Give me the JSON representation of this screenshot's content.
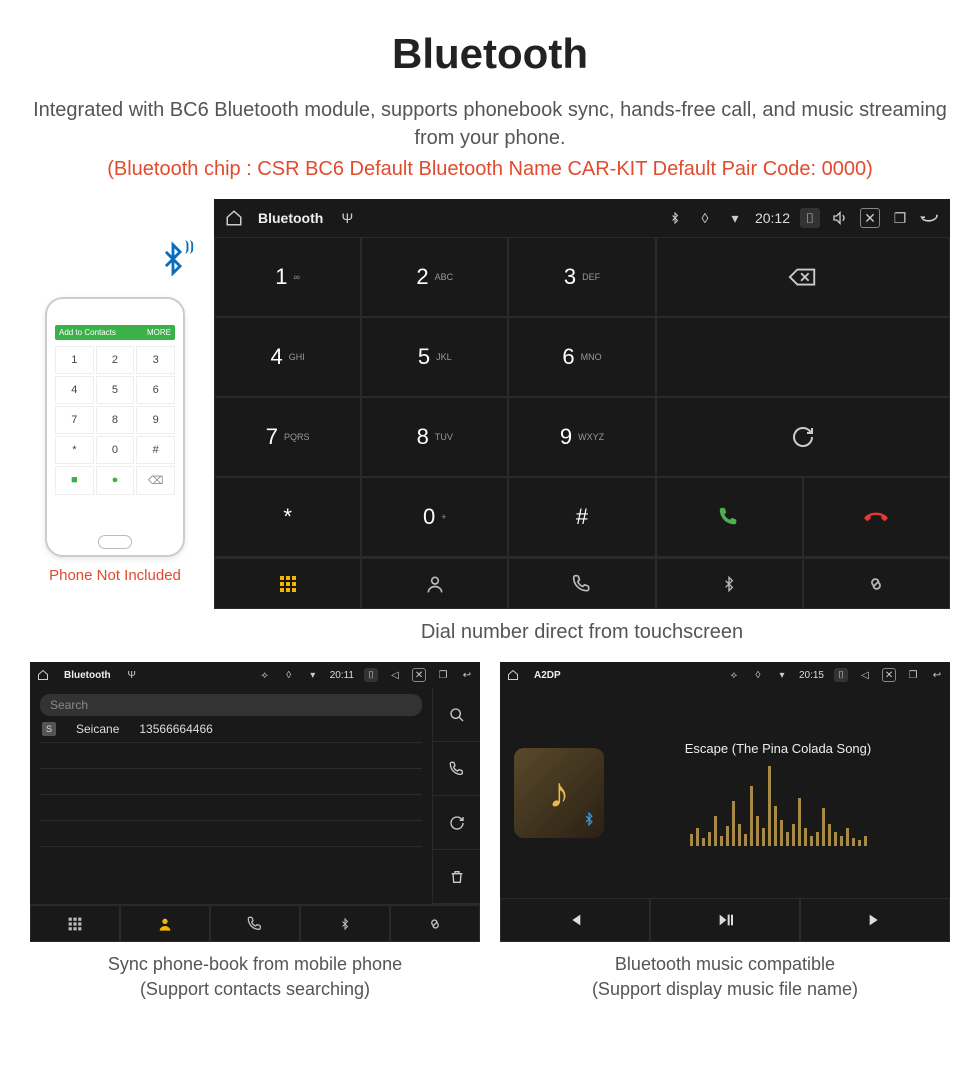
{
  "header": {
    "title": "Bluetooth",
    "subtitle": "Integrated with BC6 Bluetooth module, supports phonebook sync, hands-free call, and music streaming from your phone.",
    "meta": "(Bluetooth chip : CSR BC6    Default Bluetooth Name CAR-KIT    Default Pair Code: 0000)"
  },
  "phone": {
    "caption": "Phone Not Included",
    "add_contacts": "Add to Contacts",
    "more": "MORE",
    "keys": [
      "1",
      "2",
      "3",
      "4",
      "5",
      "6",
      "7",
      "8",
      "9",
      "*",
      "0",
      "#"
    ]
  },
  "dialer": {
    "status": {
      "title": "Bluetooth",
      "time": "20:12"
    },
    "keys": [
      {
        "d": "1",
        "s": "∞"
      },
      {
        "d": "2",
        "s": "ABC"
      },
      {
        "d": "3",
        "s": "DEF"
      },
      {
        "d": "4",
        "s": "GHI"
      },
      {
        "d": "5",
        "s": "JKL"
      },
      {
        "d": "6",
        "s": "MNO"
      },
      {
        "d": "7",
        "s": "PQRS"
      },
      {
        "d": "8",
        "s": "TUV"
      },
      {
        "d": "9",
        "s": "WXYZ"
      },
      {
        "d": "*",
        "s": ""
      },
      {
        "d": "0",
        "s": "+",
        "sup": true
      },
      {
        "d": "#",
        "s": ""
      }
    ],
    "caption": "Dial number direct from touchscreen"
  },
  "contacts": {
    "status": {
      "title": "Bluetooth",
      "time": "20:11"
    },
    "search_placeholder": "Search",
    "item": {
      "letter": "S",
      "name": "Seicane",
      "number": "13566664466"
    },
    "caption_line1": "Sync phone-book from mobile phone",
    "caption_line2": "(Support contacts searching)"
  },
  "music": {
    "status": {
      "title": "A2DP",
      "time": "20:15"
    },
    "song": "Escape (The Pina Colada Song)",
    "caption_line1": "Bluetooth music compatible",
    "caption_line2": "(Support display music file name)"
  },
  "eq_heights": [
    12,
    18,
    8,
    14,
    30,
    10,
    20,
    45,
    22,
    12,
    60,
    30,
    18,
    80,
    40,
    26,
    14,
    22,
    48,
    18,
    10,
    14,
    38,
    22,
    14,
    10,
    18,
    8,
    6,
    10
  ]
}
